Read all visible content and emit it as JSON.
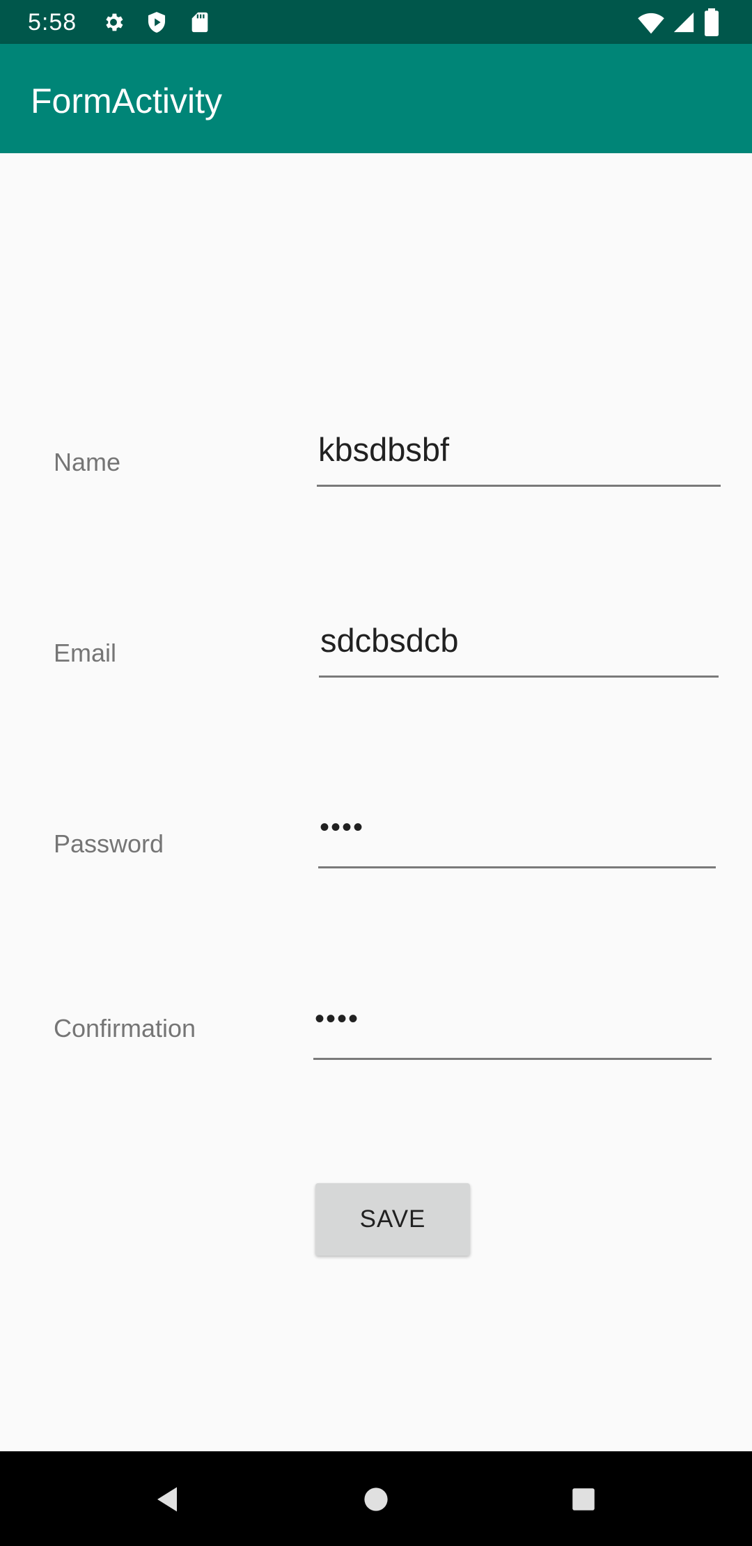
{
  "status_bar": {
    "time": "5:58",
    "icons_left": [
      "gear-icon",
      "shield-play-icon",
      "sd-card-icon"
    ],
    "icons_right": [
      "wifi-icon",
      "signal-icon",
      "battery-icon"
    ],
    "background": "#00574b"
  },
  "app_bar": {
    "title": "FormActivity",
    "background": "#008577"
  },
  "form": {
    "fields": [
      {
        "label": "Name",
        "value": "kbsdbsbf",
        "type": "text"
      },
      {
        "label": "Email",
        "value": "sdcbsdcb",
        "type": "email"
      },
      {
        "label": "Password",
        "value": "••••",
        "type": "password"
      },
      {
        "label": "Confirmation",
        "value": "••••",
        "type": "password"
      }
    ],
    "save_label": "SAVE"
  },
  "nav_bar": {
    "icons": [
      "back-icon",
      "home-icon",
      "recents-icon"
    ]
  }
}
